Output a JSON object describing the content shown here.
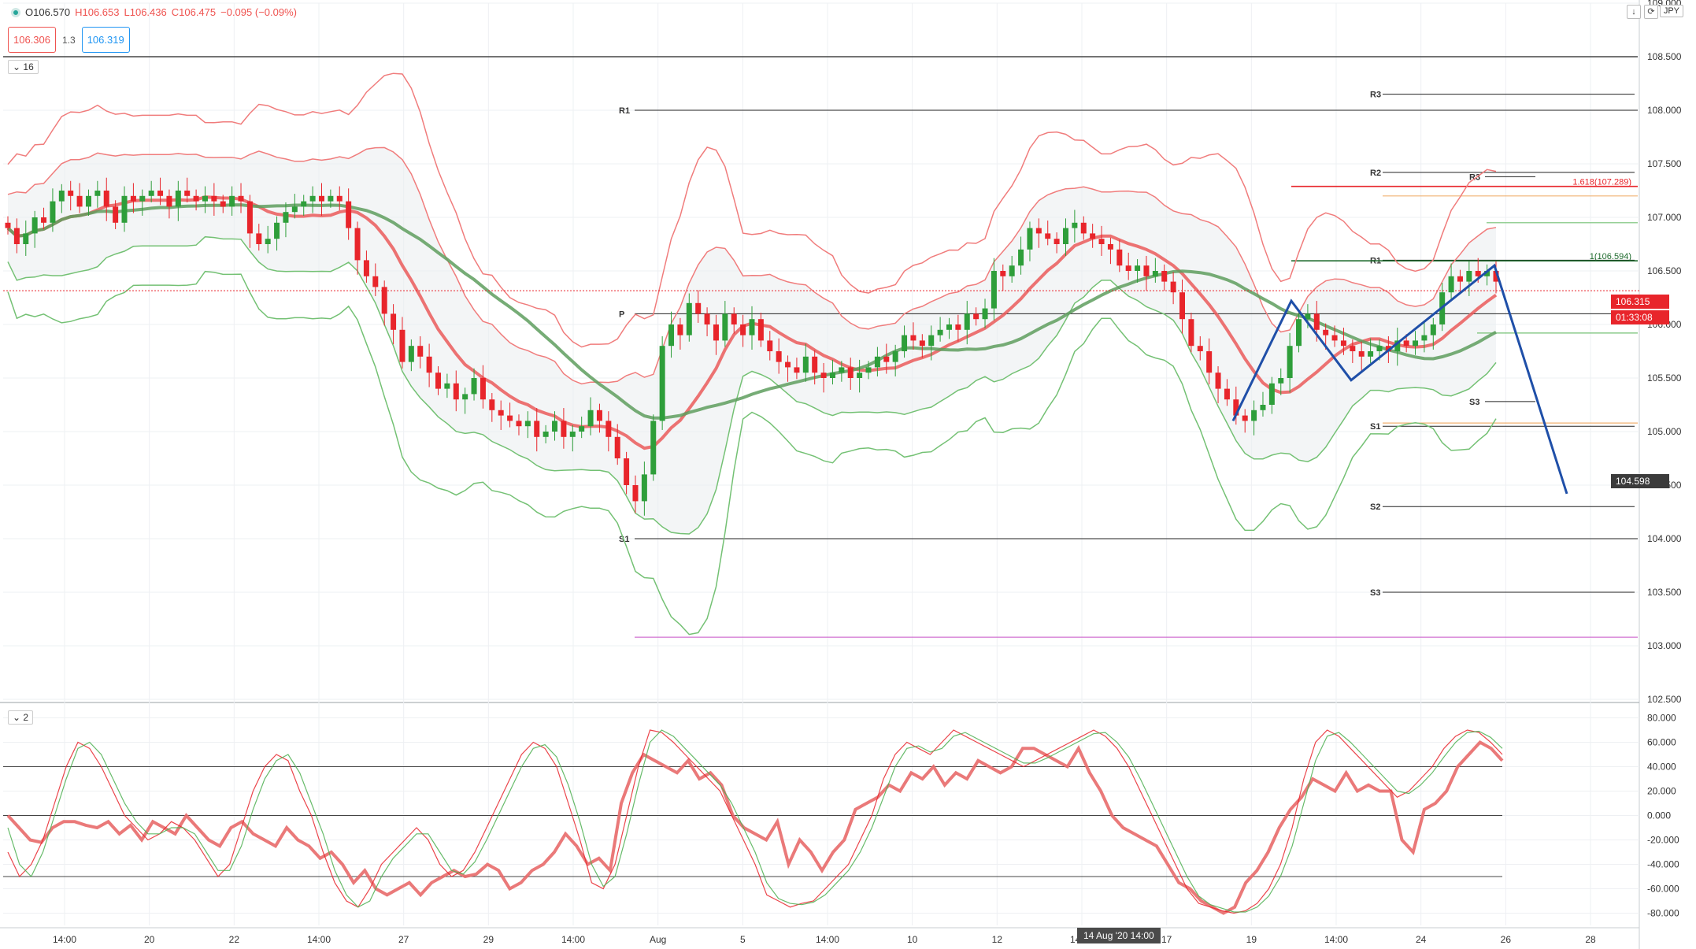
{
  "legend": {
    "open": "O106.570",
    "high": "H106.653",
    "low": "L106.436",
    "close": "C106.475",
    "change": "−0.095 (−0.09%)"
  },
  "quote": {
    "sell": "106.306",
    "spread": "1.3",
    "buy": "106.319"
  },
  "pane_labels": {
    "main": "16",
    "osc": "2"
  },
  "currency": "JPY",
  "toolbar": {
    "down_icon": "arrow-down-icon",
    "refresh_icon": "refresh-icon"
  },
  "price_tags": {
    "last": "106.315",
    "countdown": "01:33:08",
    "cursor": "104.598"
  },
  "date_tag": "14 Aug '20  14:00",
  "colors": {
    "bull": "#2e9e3a",
    "bear": "#e8252b",
    "upper_band": "#f07c7c",
    "lower_band": "#74c174",
    "pivot_line": "#222222",
    "projection": "#1f4fa8",
    "magenta": "#d070d0",
    "grid": "#eef0f3"
  },
  "chart_data": [
    {
      "type": "candlestick",
      "title": "",
      "ylim": [
        102.5,
        109.0
      ],
      "y_ticks": [
        "109.000",
        "108.500",
        "108.000",
        "107.500",
        "107.000",
        "106.500",
        "106.000",
        "105.500",
        "105.000",
        "104.500",
        "104.000",
        "103.500",
        "103.000",
        "102.500"
      ],
      "x_ticks": [
        "14:00",
        "20",
        "22",
        "14:00",
        "27",
        "29",
        "14:00",
        "Aug",
        "5",
        "14:00",
        "10",
        "12",
        "14:00",
        "17",
        "19",
        "14:00",
        "24",
        "26",
        "28"
      ],
      "grid": true,
      "candles_close": [
        106.9,
        106.75,
        106.85,
        107.0,
        106.95,
        107.15,
        107.25,
        107.2,
        107.1,
        107.2,
        107.25,
        107.1,
        106.95,
        107.2,
        107.15,
        107.2,
        107.25,
        107.2,
        107.1,
        107.25,
        107.2,
        107.15,
        107.2,
        107.15,
        107.1,
        107.2,
        107.15,
        106.85,
        106.75,
        106.8,
        106.95,
        107.05,
        107.1,
        107.15,
        107.2,
        107.15,
        107.2,
        107.15,
        106.9,
        106.6,
        106.45,
        106.35,
        106.1,
        105.95,
        105.65,
        105.8,
        105.7,
        105.55,
        105.4,
        105.45,
        105.3,
        105.35,
        105.5,
        105.3,
        105.2,
        105.15,
        105.1,
        105.05,
        105.1,
        104.95,
        105.0,
        105.1,
        104.95,
        105.0,
        105.05,
        105.2,
        105.1,
        104.95,
        104.75,
        104.5,
        104.35,
        104.6,
        105.1,
        105.8,
        106.0,
        105.9,
        106.2,
        106.1,
        106.0,
        105.85,
        106.1,
        106.0,
        105.9,
        106.05,
        105.85,
        105.75,
        105.65,
        105.6,
        105.55,
        105.7,
        105.55,
        105.5,
        105.55,
        105.6,
        105.5,
        105.55,
        105.6,
        105.7,
        105.65,
        105.75,
        105.9,
        105.85,
        105.8,
        105.9,
        105.95,
        106.0,
        105.95,
        106.1,
        106.05,
        106.15,
        106.5,
        106.45,
        106.55,
        106.7,
        106.9,
        106.85,
        106.8,
        106.75,
        106.9,
        106.95,
        106.85,
        106.8,
        106.75,
        106.7,
        106.55,
        106.5,
        106.55,
        106.45,
        106.5,
        106.4,
        106.3,
        106.05,
        105.8,
        105.75,
        105.55,
        105.4,
        105.3,
        105.15,
        105.1,
        105.2,
        105.25,
        105.45,
        105.5,
        105.8,
        106.05,
        106.1,
        105.95,
        105.9,
        105.85,
        105.8,
        105.75,
        105.7,
        105.75,
        105.8,
        105.75,
        105.85,
        105.8,
        105.85,
        105.9,
        106.0,
        106.3,
        106.45,
        106.4,
        106.5,
        106.45,
        106.5,
        106.4
      ],
      "moving_averages": [
        "center-line",
        "slow-green-ma"
      ],
      "bands": [
        "upper-outer",
        "upper-inner",
        "lower-inner",
        "lower-outer"
      ],
      "pivot_levels_left": [
        {
          "label": "R1",
          "value": 108.0
        },
        {
          "label": "P",
          "value": 106.1
        },
        {
          "label": "S1",
          "value": 104.0
        }
      ],
      "pivot_levels_right": [
        {
          "label": "R3",
          "value": 108.15
        },
        {
          "label": "R2",
          "value": 107.42
        },
        {
          "label": "R1",
          "value": 106.6
        },
        {
          "label": "S1",
          "value": 105.05
        },
        {
          "label": "S2",
          "value": 104.3
        },
        {
          "label": "S3",
          "value": 103.5
        }
      ],
      "pivot_levels_inner": [
        {
          "label": "R3",
          "value": 107.38
        },
        {
          "label": "S3",
          "value": 105.28
        }
      ],
      "fib_levels": [
        {
          "label": "1.618(107.289)",
          "value": 107.289
        },
        {
          "label": "1(106.594)",
          "value": 106.594
        }
      ],
      "horizontal_lines": [
        108.5,
        109.05,
        103.08
      ],
      "projection_path": [
        [
          105.1,
          "start"
        ],
        [
          106.22,
          "peak"
        ],
        [
          105.48,
          "trough"
        ],
        [
          106.55,
          "high"
        ],
        [
          104.42,
          "target"
        ]
      ]
    },
    {
      "type": "line",
      "title": "",
      "ylim": [
        -90,
        90
      ],
      "y_ticks": [
        "80.000",
        "60.000",
        "40.000",
        "20.000",
        "0.000",
        "-20.000",
        "-40.000",
        "-60.000",
        "-80.000"
      ],
      "levels": [
        40,
        0,
        -50
      ],
      "series": [
        {
          "values": [
            0,
            -10,
            -20,
            -22,
            -10,
            -5,
            -5,
            -8,
            -10,
            -5,
            -15,
            -8,
            -20,
            -5,
            -10,
            -15,
            0,
            -10,
            -20,
            -25,
            -10,
            -5,
            -15,
            -20,
            -25,
            -10,
            -20,
            -25,
            -35,
            -30,
            -40,
            -55,
            -45,
            -60,
            -65,
            -60,
            -55,
            -65,
            -55,
            -50,
            -45,
            -50,
            -48,
            -40,
            -45,
            -60,
            -55,
            -45,
            -40,
            -30,
            -15,
            -25,
            -40,
            -35,
            -45,
            10,
            35,
            50,
            45,
            40,
            35,
            45,
            30,
            35,
            25,
            0,
            -10,
            -15,
            -20,
            -5,
            -40,
            -20,
            -30,
            -45,
            -30,
            -20,
            5,
            10,
            15,
            25,
            20,
            35,
            30,
            40,
            25,
            35,
            30,
            45,
            40,
            35,
            40,
            55,
            55,
            50,
            45,
            40,
            55,
            35,
            20,
            0,
            -10,
            -15,
            -20,
            -25,
            -40,
            -55,
            -60,
            -70,
            -75,
            -80,
            -75,
            -55,
            -45,
            -30,
            -10,
            5,
            15,
            30,
            25,
            20,
            35,
            20,
            25,
            20,
            20,
            -20,
            -30,
            5,
            10,
            20,
            40,
            50,
            60,
            55,
            45
          ]
        },
        {
          "values": [
            -30,
            -50,
            -40,
            -20,
            10,
            40,
            60,
            55,
            40,
            20,
            0,
            -10,
            -20,
            -15,
            -5,
            -10,
            -20,
            -35,
            -50,
            -40,
            -10,
            20,
            40,
            50,
            45,
            20,
            0,
            -30,
            -55,
            -70,
            -75,
            -60,
            -40,
            -30,
            -20,
            -10,
            -20,
            -40,
            -50,
            -45,
            -30,
            -10,
            10,
            30,
            50,
            60,
            55,
            40,
            10,
            -20,
            -55,
            -60,
            -40,
            0,
            40,
            70,
            68,
            60,
            50,
            40,
            30,
            20,
            0,
            -20,
            -40,
            -65,
            -70,
            -75,
            -72,
            -70,
            -60,
            -50,
            -40,
            -20,
            0,
            30,
            50,
            60,
            55,
            50,
            60,
            70,
            65,
            60,
            55,
            50,
            45,
            40,
            45,
            50,
            55,
            60,
            65,
            70,
            65,
            55,
            40,
            20,
            0,
            -20,
            -40,
            -60,
            -72,
            -75,
            -78,
            -80,
            -78,
            -72,
            -60,
            -40,
            -10,
            30,
            60,
            70,
            65,
            55,
            45,
            35,
            25,
            15,
            20,
            30,
            40,
            55,
            65,
            70,
            68,
            60,
            50
          ]
        },
        {
          "values": [
            -10,
            -40,
            -50,
            -30,
            0,
            30,
            55,
            60,
            50,
            30,
            10,
            -5,
            -15,
            -15,
            -10,
            -10,
            -15,
            -30,
            -45,
            -45,
            -25,
            5,
            30,
            45,
            50,
            35,
            10,
            -15,
            -45,
            -65,
            -75,
            -70,
            -50,
            -35,
            -25,
            -15,
            -15,
            -30,
            -45,
            -48,
            -38,
            -20,
            0,
            20,
            40,
            55,
            58,
            48,
            25,
            -5,
            -40,
            -58,
            -50,
            -15,
            25,
            60,
            70,
            65,
            55,
            45,
            35,
            25,
            10,
            -10,
            -30,
            -55,
            -68,
            -72,
            -73,
            -71,
            -65,
            -55,
            -45,
            -30,
            -10,
            15,
            40,
            55,
            57,
            52,
            55,
            65,
            68,
            63,
            58,
            53,
            48,
            43,
            43,
            47,
            52,
            57,
            62,
            67,
            68,
            60,
            48,
            30,
            10,
            -10,
            -30,
            -50,
            -66,
            -73,
            -76,
            -79,
            -79,
            -75,
            -66,
            -50,
            -25,
            10,
            45,
            65,
            68,
            60,
            50,
            40,
            30,
            20,
            18,
            25,
            35,
            48,
            60,
            68,
            69,
            64,
            55
          ]
        }
      ]
    }
  ]
}
